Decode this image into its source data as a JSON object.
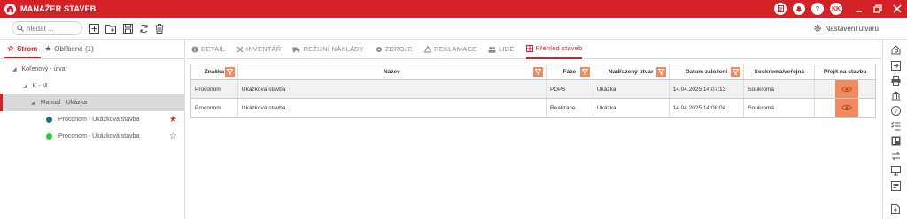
{
  "app": {
    "title": "MANAŽER STAVEB"
  },
  "titlebar": {
    "help_label": "?",
    "user_initials": "KK"
  },
  "toolbar": {
    "search_placeholder": "hledat ...",
    "settings_label": "Nastavení útvaru"
  },
  "left_tabs": {
    "tree_label": "Strom",
    "favorites_label": "Oblíbené (1)"
  },
  "tree": {
    "items": [
      {
        "label": "Kořenový - útvar"
      },
      {
        "label": "K - M"
      },
      {
        "label": "Manuál - Ukázka"
      },
      {
        "label": "Proconom  -  Ukázková stavba",
        "dot_color": "#1f6f7e",
        "starred": true
      },
      {
        "label": "Proconom  -  Ukázková stavba",
        "dot_color": "#2ecc40",
        "starred": false
      }
    ]
  },
  "tabs": [
    {
      "label": "DETAIL",
      "icon": "info-icon"
    },
    {
      "label": "INVENTÁŘ",
      "icon": "tools-icon"
    },
    {
      "label": "REŽIJNÍ NÁKLADY",
      "icon": "truck-icon"
    },
    {
      "label": "ZDROJE",
      "icon": "gear-icon"
    },
    {
      "label": "REKLAMACE",
      "icon": "recycle-icon"
    },
    {
      "label": "LIDÉ",
      "icon": "people-icon"
    },
    {
      "label": "Přehled staveb",
      "icon": "grid-icon",
      "active": true
    }
  ],
  "grid": {
    "columns": [
      "Značka",
      "Název",
      "Fáze",
      "Nadřazený útvar",
      "Datum založení",
      "Soukromá/veřejná",
      "Přejít na stavbu"
    ],
    "rows": [
      {
        "znacka": "Proconom",
        "nazev": "Ukázková stavba",
        "faze": "PDPS",
        "utvar": "Ukázka",
        "datum": "14.04.2025 14:07:13",
        "typ": "Soukromá"
      },
      {
        "znacka": "Proconom",
        "nazev": "Ukázková stavba",
        "faze": "Realizace",
        "utvar": "Ukázka",
        "datum": "14.04.2025 14:08:04",
        "typ": "Soukromá"
      }
    ]
  },
  "colors": {
    "brand": "#d42128",
    "filter": "#f28a5f",
    "selected_row": "#d9d9d9"
  }
}
